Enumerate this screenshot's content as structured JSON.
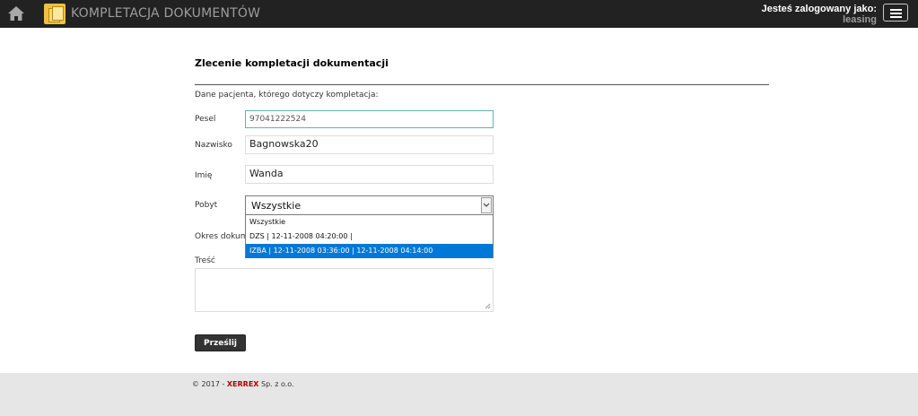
{
  "header": {
    "app_title": "KOMPLETACJA DOKUMENTÓW",
    "logged_label": "Jesteś zalogowany jako:",
    "username": "leasing",
    "icons": [
      "home-icon",
      "app-logo-icon",
      "hamburger-menu-icon"
    ]
  },
  "form": {
    "title": "Zlecenie kompletacji dokumentacji",
    "section_label": "Dane pacjenta, którego dotyczy kompletacja:",
    "pesel": {
      "label": "Pesel",
      "value": "97041222524"
    },
    "nazwisko": {
      "label": "Nazwisko",
      "value": "Bagnowska20"
    },
    "imie": {
      "label": "Imię",
      "value": "Wanda"
    },
    "pobyt": {
      "label": "Pobyt",
      "value": "Wszystkie",
      "options": [
        "Wszystkie",
        "DZS | 12-11-2008 04:20:00 |",
        "IZBA | 12-11-2008 03:36:00 | 12-11-2008 04:14:00"
      ],
      "highlighted_index": 2
    },
    "okres_label": "Okres dokum",
    "tresc_label": "Treść",
    "submit_label": "Prześlij"
  },
  "footer": {
    "prefix": "© 2017 - ",
    "brand": "XERREX",
    "suffix": " Sp. z o.o."
  },
  "colors": {
    "topbar": "#222222",
    "accent_highlight": "#0078d7",
    "brand_red": "#b00000"
  }
}
